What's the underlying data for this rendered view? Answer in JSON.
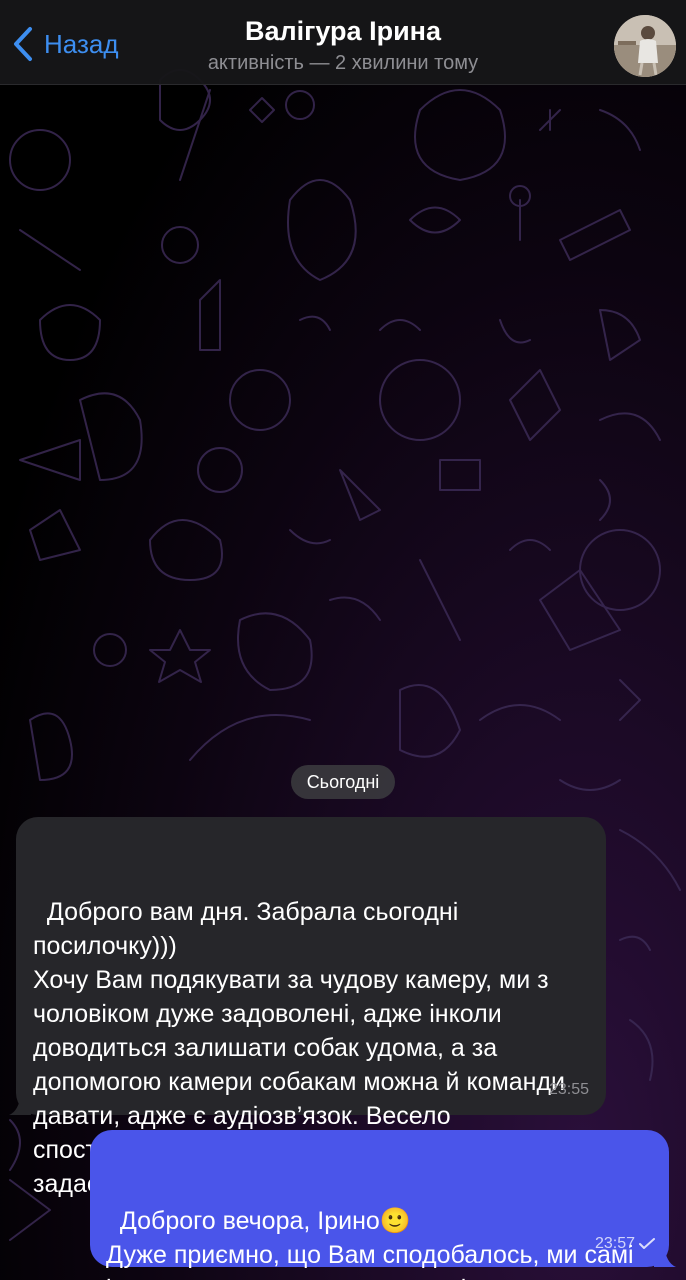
{
  "header": {
    "back_label": "Назад",
    "title": "Валігура Ірина",
    "subtitle": "активність — 2 хвилини тому"
  },
  "date_divider": "Сьогодні",
  "messages": [
    {
      "direction": "incoming",
      "text": "Доброго вам дня. Забрала сьогодні посилочку)))\nХочу Вам подякувати за чудову камеру, ми з чоловіком дуже задоволені, адже інколи доводиться залишати собак удома, а за допомогою камери собакам можна й команди давати, адже є аудіозв’язок. Весело спостерігати, як собаки виконують команди, які задає їм камера😂",
      "time": "23:55"
    },
    {
      "direction": "outgoing",
      "text": "Доброго вечора, Ірино🙂\nДуже приємно, що Вам сподобалось, ми самі інколи задаємо завдання працівникам складу через камеру 😅",
      "time": "23:57",
      "status": "read"
    }
  ],
  "colors": {
    "accent": "#3d8ef0",
    "incoming_bubble": "#26262a",
    "outgoing_bubble": "#4a55ea",
    "background": "#000000"
  }
}
